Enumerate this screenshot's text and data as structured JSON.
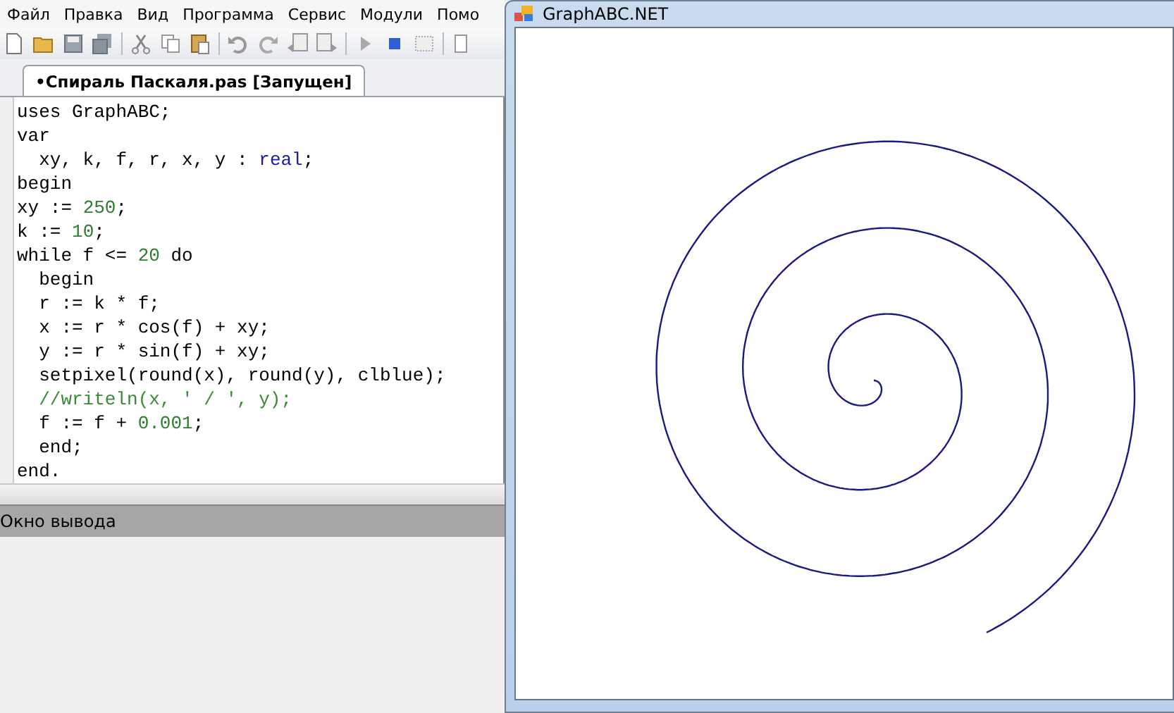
{
  "menu": [
    {
      "label": "Файл"
    },
    {
      "label": "Правка"
    },
    {
      "label": "Вид"
    },
    {
      "label": "Программа"
    },
    {
      "label": "Сервис"
    },
    {
      "label": "Модули"
    },
    {
      "label": "Помо"
    }
  ],
  "tabs": [
    {
      "label": "•Спираль Паскаля.pas [Запущен]",
      "selected": true
    }
  ],
  "code": [
    [
      {
        "kind": "plain",
        "text": "uses GraphABC;"
      }
    ],
    [
      {
        "kind": "plain",
        "text": "var"
      }
    ],
    [
      {
        "kind": "plain",
        "text": "  xy, k, f, r, x, y : "
      },
      {
        "kind": "type",
        "text": "real"
      },
      {
        "kind": "plain",
        "text": ";"
      }
    ],
    [
      {
        "kind": "plain",
        "text": "begin"
      }
    ],
    [
      {
        "kind": "plain",
        "text": "xy := "
      },
      {
        "kind": "number",
        "text": "250"
      },
      {
        "kind": "plain",
        "text": ";"
      }
    ],
    [
      {
        "kind": "plain",
        "text": "k := "
      },
      {
        "kind": "number",
        "text": "10"
      },
      {
        "kind": "plain",
        "text": ";"
      }
    ],
    [
      {
        "kind": "plain",
        "text": "while f <= "
      },
      {
        "kind": "number",
        "text": "20"
      },
      {
        "kind": "plain",
        "text": " do"
      }
    ],
    [
      {
        "kind": "plain",
        "text": "  begin"
      }
    ],
    [
      {
        "kind": "plain",
        "text": "  r := k * f;"
      }
    ],
    [
      {
        "kind": "plain",
        "text": "  x := r * cos(f) + xy;"
      }
    ],
    [
      {
        "kind": "plain",
        "text": "  y := r * sin(f) + xy;"
      }
    ],
    [
      {
        "kind": "plain",
        "text": "  setpixel(round(x), round(y), clblue);"
      }
    ],
    [
      {
        "kind": "comment",
        "text": "  //writeln(x, ' / ', y);"
      }
    ],
    [
      {
        "kind": "plain",
        "text": "  f := f + "
      },
      {
        "kind": "number",
        "text": "0.001"
      },
      {
        "kind": "plain",
        "text": ";"
      }
    ],
    [
      {
        "kind": "plain",
        "text": "  end;"
      }
    ],
    [
      {
        "kind": "plain",
        "text": "end."
      }
    ]
  ],
  "status_bar": {
    "label": "Окно вывода"
  },
  "output_window": {
    "title": "GraphABC.NET"
  }
}
